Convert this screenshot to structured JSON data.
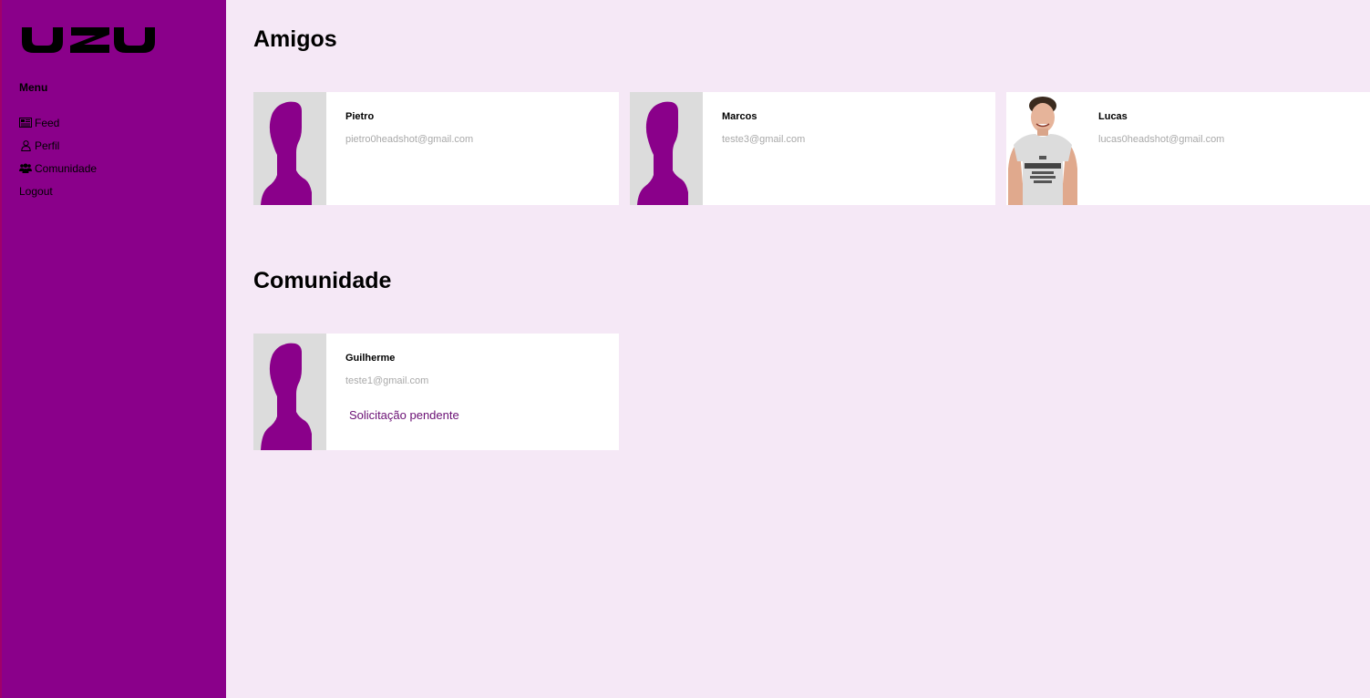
{
  "sidebar": {
    "logo_text": "UZU",
    "menu_title": "Menu",
    "items": [
      {
        "label": "Feed",
        "icon": "newspaper-icon"
      },
      {
        "label": "Perfil",
        "icon": "user-icon"
      },
      {
        "label": "Comunidade",
        "icon": "users-icon"
      },
      {
        "label": "Logout",
        "icon": ""
      }
    ]
  },
  "friends": {
    "title": "Amigos",
    "cards": [
      {
        "name": "Pietro",
        "email": "pietro0headshot@gmail.com",
        "avatar": "default-silhouette"
      },
      {
        "name": "Marcos",
        "email": "teste3@gmail.com",
        "avatar": "default-silhouette"
      },
      {
        "name": "Lucas",
        "email": "lucas0headshot@gmail.com",
        "avatar": "photo"
      }
    ]
  },
  "community": {
    "title": "Comunidade",
    "cards": [
      {
        "name": "Guilherme",
        "email": "teste1@gmail.com",
        "avatar": "default-silhouette",
        "status": "Solicitação pendente"
      }
    ]
  },
  "colors": {
    "sidebar_bg": "#8a008a",
    "page_bg": "#f5e8f6",
    "accent": "#8a008a",
    "pending_text": "#6a0f74"
  }
}
